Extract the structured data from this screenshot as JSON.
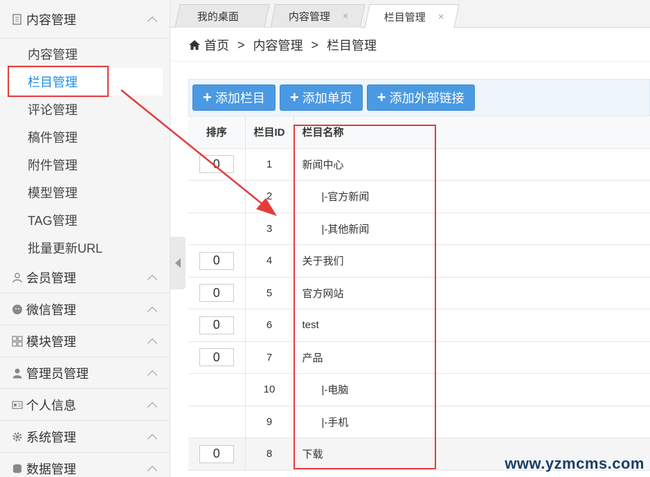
{
  "sidebar": {
    "groups": [
      {
        "label": "内容管理",
        "icon": "document-icon"
      },
      {
        "label": "会员管理",
        "icon": "user-icon"
      },
      {
        "label": "微信管理",
        "icon": "wechat-icon"
      },
      {
        "label": "模块管理",
        "icon": "grid-icon"
      },
      {
        "label": "管理员管理",
        "icon": "admin-icon"
      },
      {
        "label": "个人信息",
        "icon": "id-card-icon"
      },
      {
        "label": "系统管理",
        "icon": "gear-icon"
      },
      {
        "label": "数据管理",
        "icon": "database-icon"
      }
    ],
    "content_items": [
      "内容管理",
      "栏目管理",
      "评论管理",
      "稿件管理",
      "附件管理",
      "模型管理",
      "TAG管理",
      "批量更新URL"
    ]
  },
  "tabs": [
    {
      "label": "我的桌面",
      "closable": false
    },
    {
      "label": "内容管理",
      "closable": true,
      "close": "×"
    },
    {
      "label": "栏目管理",
      "closable": true,
      "close": "×"
    }
  ],
  "breadcrumb": {
    "home": "首页",
    "sep": ">",
    "level1": "内容管理",
    "level2": "栏目管理"
  },
  "toolbar": {
    "plus": "+",
    "add_category": "添加栏目",
    "add_page": "添加单页",
    "add_link": "添加外部链接"
  },
  "table": {
    "headers": {
      "order": "排序",
      "id": "栏目ID",
      "name": "栏目名称"
    },
    "rows": [
      {
        "order": "0",
        "id": "1",
        "name": "新闻中心"
      },
      {
        "order": "",
        "id": "2",
        "name": "|-官方新闻"
      },
      {
        "order": "",
        "id": "3",
        "name": "|-其他新闻"
      },
      {
        "order": "0",
        "id": "4",
        "name": "关于我们"
      },
      {
        "order": "0",
        "id": "5",
        "name": "官方网站"
      },
      {
        "order": "0",
        "id": "6",
        "name": "test"
      },
      {
        "order": "0",
        "id": "7",
        "name": "产品"
      },
      {
        "order": "",
        "id": "10",
        "name": "|-电脑"
      },
      {
        "order": "",
        "id": "9",
        "name": "|-手机"
      },
      {
        "order": "0",
        "id": "8",
        "name": "下载"
      }
    ]
  },
  "watermark": "www.yzmcms.com",
  "colors": {
    "accent": "#4a9ae3",
    "active_link": "#1e8ee6",
    "highlight": "#e43b3b"
  }
}
